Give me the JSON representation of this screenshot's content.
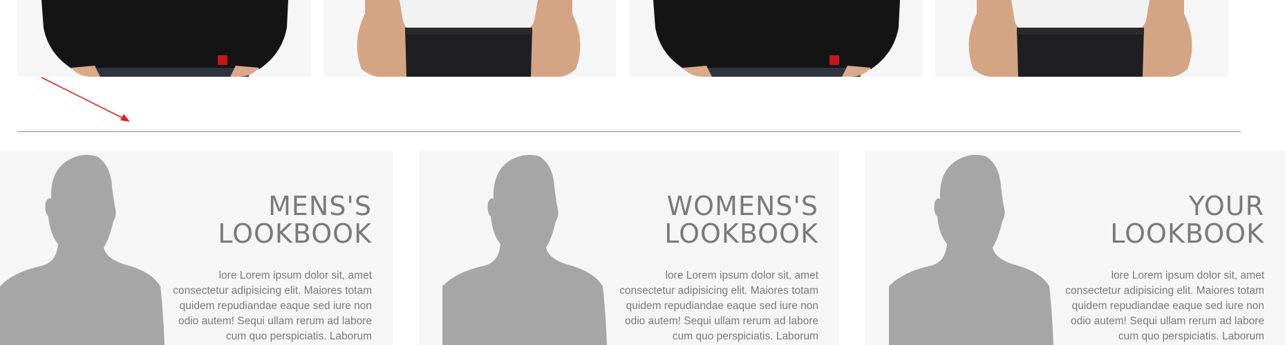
{
  "products": [
    {
      "shirt": "black",
      "shirt_color": "#141414",
      "pants_color": "#2f3340"
    },
    {
      "shirt": "white",
      "shirt_color": "#f2f2f2",
      "pants_color": "#1f1f22"
    },
    {
      "shirt": "black",
      "shirt_color": "#141414",
      "pants_color": "#2f3340"
    },
    {
      "shirt": "white",
      "shirt_color": "#f2f2f2",
      "pants_color": "#1f1f22"
    }
  ],
  "lookbooks": [
    {
      "title_line1": "MENS'S",
      "title_line2": "LOOKBOOK",
      "body": "lore Lorem ipsum dolor sit, amet consectetur adipisicing elit. Maiores totam quidem repudiandae eaque sed iure non odio autem! Sequi ullam rerum ad labore cum quo perspiciatis. Laborum"
    },
    {
      "title_line1": "WOMENS'S",
      "title_line2": "LOOKBOOK",
      "body": "lore Lorem ipsum dolor sit, amet consectetur adipisicing elit. Maiores totam quidem repudiandae eaque sed iure non odio autem! Sequi ullam rerum ad labore cum quo perspiciatis. Laborum"
    },
    {
      "title_line1": "YOUR",
      "title_line2": "LOOKBOOK",
      "body": "lore Lorem ipsum dolor sit, amet consectetur adipisicing elit. Maiores totam quidem repudiandae eaque sed iure non odio autem! Sequi ullam rerum ad labore cum quo perspiciatis. Laborum"
    }
  ],
  "colors": {
    "card_bg": "#f6f6f6",
    "text": "#7a7a7a",
    "silhouette": "#a6a6a6",
    "arrow": "#e02020",
    "divider": "#8c8c8c"
  }
}
